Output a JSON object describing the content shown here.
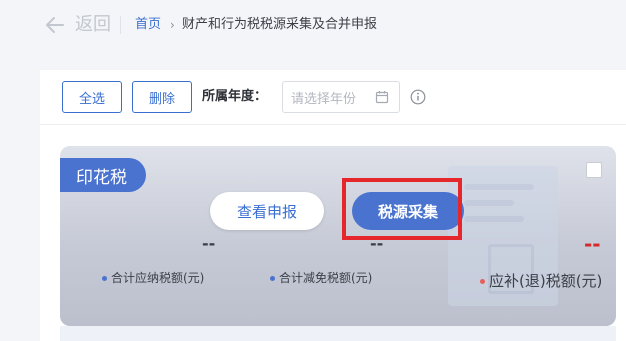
{
  "nav": {
    "back_label": "返回",
    "breadcrumb": {
      "home": "首页",
      "separator": "›",
      "current": "财产和行为税税源采集及合并申报"
    }
  },
  "toolbar": {
    "select_all_label": "全选",
    "delete_label": "删除",
    "year_label": "所属年度：",
    "year_placeholder": "请选择年份"
  },
  "card": {
    "tax_name": "印花税",
    "view_button_label": "查看申报",
    "collect_button_label": "税源采集",
    "metrics": [
      {
        "value": "--",
        "label": "合计应纳税额(元)"
      },
      {
        "value": "--",
        "label": "合计减免税额(元)"
      },
      {
        "value": "--",
        "label": "应补(退)税额(元)"
      }
    ]
  },
  "colors": {
    "accent": "#4a73cf",
    "link": "#3a6fd0",
    "highlight": "#e5262a",
    "negative": "#d6282a"
  },
  "icons": {
    "back": "arrow-left-icon",
    "calendar": "calendar-icon",
    "info": "info-icon"
  }
}
